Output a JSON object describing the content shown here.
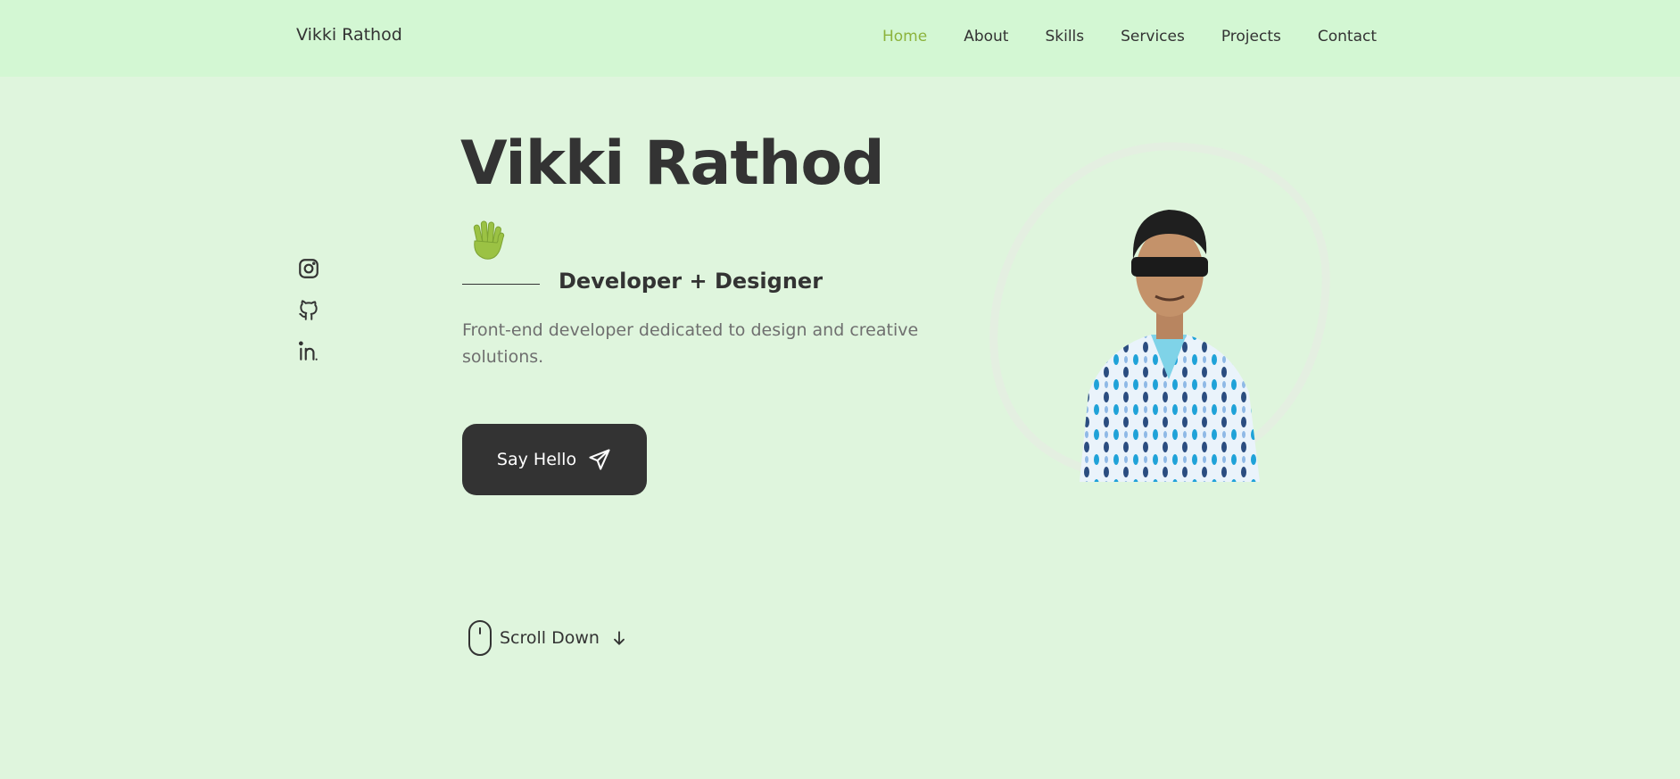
{
  "header": {
    "logo": "Vikki Rathod",
    "nav": [
      {
        "label": "Home",
        "active": true
      },
      {
        "label": "About"
      },
      {
        "label": "Skills"
      },
      {
        "label": "Services"
      },
      {
        "label": "Projects"
      },
      {
        "label": "Contact"
      }
    ]
  },
  "social": [
    {
      "icon": "instagram-icon"
    },
    {
      "icon": "github-icon"
    },
    {
      "icon": "linkedin-icon"
    }
  ],
  "hero": {
    "title": "Vikki Rathod",
    "wave_icon": "waving-hand-icon",
    "subtitle": "Developer + Designer",
    "description": "Front-end developer dedicated to design and creative solutions.",
    "cta_label": "Say Hello",
    "cta_icon": "send-icon",
    "scroll_label": "Scroll Down"
  },
  "colors": {
    "background": "#dff5dd",
    "header_bg": "#d3f7d3",
    "accent": "#8cb33c",
    "text": "#333333",
    "muted": "#6f6f6f"
  }
}
